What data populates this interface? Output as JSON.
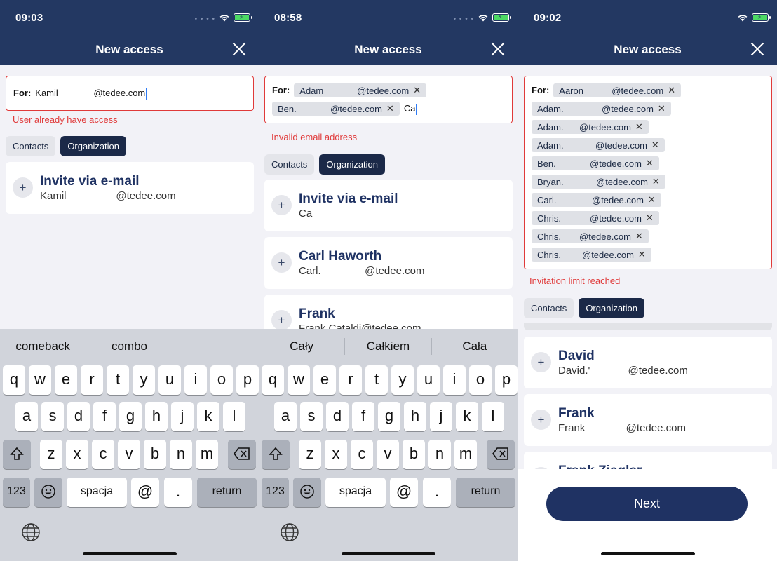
{
  "screens": [
    {
      "time": "09:03",
      "title": "New access",
      "for_label": "For:",
      "typed_text": "Kamil              @tedee.com",
      "error": "User already have access",
      "tabs": [
        "Contacts",
        "Organization"
      ],
      "active_tab": "Organization",
      "cards": [
        {
          "title": "Invite via e-mail",
          "subtitle": "Kamil                 @tedee.com"
        }
      ],
      "suggestions": [
        "comeback",
        "combo",
        ""
      ]
    },
    {
      "time": "08:58",
      "title": "New access",
      "for_label": "For:",
      "chips": [
        {
          "name": "Adam",
          "email": "@tedee.com"
        },
        {
          "name": "Ben.",
          "email": "@tedee.com"
        }
      ],
      "typed_text": "Ca",
      "error": "Invalid email address",
      "tabs": [
        "Contacts",
        "Organization"
      ],
      "active_tab": "Organization",
      "cards": [
        {
          "title": "Invite via e-mail",
          "subtitle": "Ca"
        },
        {
          "title": "Carl Haworth",
          "subtitle": "Carl.               @tedee.com"
        },
        {
          "title": "Frank",
          "subtitle": "Frank.Cataldi@tedee.com"
        }
      ],
      "suggestions": [
        "Cały",
        "Całkiem",
        "Cała"
      ]
    },
    {
      "time": "09:02",
      "title": "New access",
      "for_label": "For:",
      "chips": [
        {
          "name": "Aaron",
          "email": "@tedee.com"
        },
        {
          "name": "Adam.",
          "email": "@tedee.com"
        },
        {
          "name": "Adam.",
          "email": "@tedee.com"
        },
        {
          "name": "Adam.",
          "email": "@tedee.com"
        },
        {
          "name": "Ben.",
          "email": "@tedee.com"
        },
        {
          "name": "Bryan.",
          "email": "@tedee.com"
        },
        {
          "name": "Carl.",
          "email": "@tedee.com"
        },
        {
          "name": "Chris.",
          "email": "@tedee.com"
        },
        {
          "name": "Chris.",
          "email": "@tedee.com"
        },
        {
          "name": "Chris.",
          "email": "@tedee.com"
        }
      ],
      "error": "Invitation limit reached",
      "tabs": [
        "Contacts",
        "Organization"
      ],
      "active_tab": "Organization",
      "cards": [
        {
          "title": "David",
          "subtitle": "David.'             @tedee.com"
        },
        {
          "title": "Frank",
          "subtitle": "Frank              @tedee.com"
        },
        {
          "title": "Frank Ziegler",
          "subtitle": ""
        }
      ],
      "next_label": "Next"
    }
  ],
  "keyboard": {
    "row1": [
      "q",
      "w",
      "e",
      "r",
      "t",
      "y",
      "u",
      "i",
      "o",
      "p"
    ],
    "row2": [
      "a",
      "s",
      "d",
      "f",
      "g",
      "h",
      "j",
      "k",
      "l"
    ],
    "row3": [
      "z",
      "x",
      "c",
      "v",
      "b",
      "n",
      "m"
    ],
    "numbers_label": "123",
    "space_label": "spacja",
    "at_label": "@",
    "dot_label": ".",
    "return_label": "return"
  }
}
